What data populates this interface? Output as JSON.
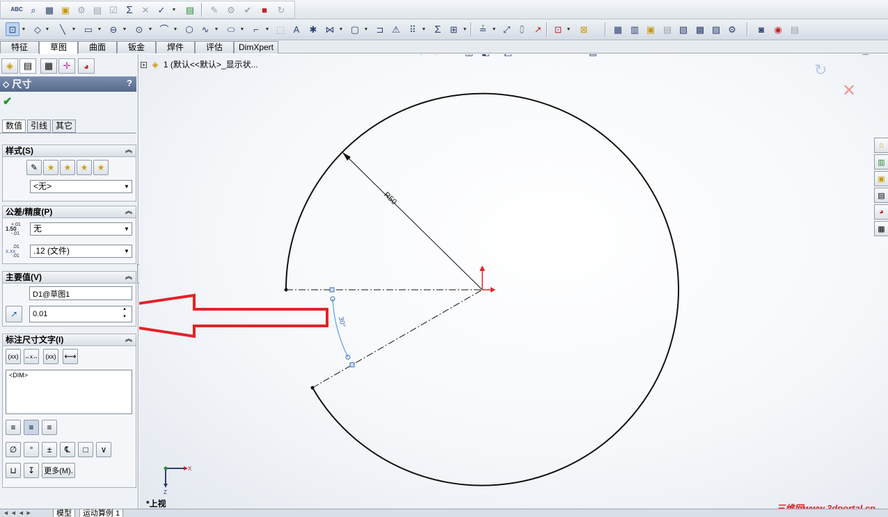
{
  "cm_tabs": [
    "特征",
    "草图",
    "曲面",
    "钣金",
    "焊件",
    "评估",
    "DimXpert"
  ],
  "cm_active_tab": "草图",
  "toolbar1_icons": [
    "spell-check-icon",
    "search-icon",
    "ruler-icon",
    "folder-icon",
    "gear-icon",
    "lock-icon",
    "check-icon",
    "sigma-icon",
    "tools-icon",
    "curve-icon",
    "dropdown-icon",
    "export-icon",
    "pen-icon",
    "gear2-icon",
    "check2-icon",
    "color-icon",
    "refresh-icon"
  ],
  "toolbar2_icons": [
    "sketch-icon",
    "smart-dimension-icon",
    "line-icon",
    "rectangle-icon",
    "slot-icon",
    "circle-icon",
    "arc-icon",
    "polygon-icon",
    "spline-icon",
    "ellipse-icon",
    "fillet-icon",
    "construction-icon",
    "text-icon",
    "point-icon",
    "trim-icon",
    "offset-icon",
    "mirror-icon",
    "warning-icon",
    "pattern-icon",
    "sigma-icon",
    "relations-icon",
    "rebuild-icon",
    "move-icon",
    "split-icon",
    "repair-icon",
    "quick-snap-icon"
  ],
  "pm": {
    "title": "尺寸",
    "help": "?",
    "tabs": [
      "数值",
      "引线",
      "其它"
    ],
    "active_tab": "数值",
    "style": {
      "header": "样式(S)",
      "dropdown": "<无>"
    },
    "tolerance": {
      "header": "公差/精度(P)",
      "tol_icon_text": "1.50",
      "tol_icon_sup": "+.01",
      "tol_icon_sub": "-.01",
      "tol_value": "无",
      "prec_icon_text": "x.xx",
      "prec_icon_sup": ".01",
      "prec_icon_sub": ".01",
      "prec_value": ".12 (文件)"
    },
    "primary": {
      "header": "主要值(V)",
      "name": "D1@草图1",
      "value": "0.01"
    },
    "dim_text": {
      "header": "标注尺寸文字(I)",
      "buttons": [
        "(xx)",
        "↔x↔",
        "(xx)",
        "⟷"
      ],
      "content": "<DIM>",
      "symbols": [
        "∅",
        "°",
        "±",
        "℄",
        "□",
        "∨",
        "⊔",
        "↧"
      ],
      "more": "更多(M)."
    }
  },
  "tree": {
    "item": "1  (默认<<默认>_显示状..."
  },
  "sketch": {
    "radius_label": "R50",
    "angle_label": "30°"
  },
  "triad": {
    "x": "X",
    "z": "Z",
    "view": "*上视"
  },
  "bottom_tabs": [
    "模型",
    "运动算例 1"
  ],
  "watermark": "三维网www.3dportal.cn",
  "colors": {
    "arrow": "#e3222a",
    "dimension_arc": "#5a9be0",
    "origin": "#e3222a",
    "title_bar": "#6a7fa0",
    "accept": "#1e9a2a"
  }
}
